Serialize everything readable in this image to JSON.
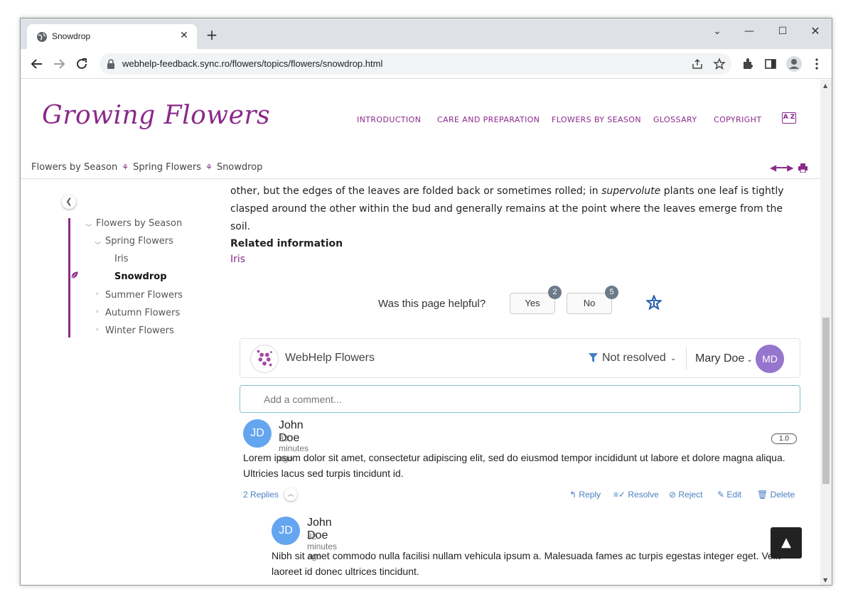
{
  "browser": {
    "tab_title": "Snowdrop",
    "url": "webhelp-feedback.sync.ro/flowers/topics/flowers/snowdrop.html"
  },
  "site": {
    "logo": "Growing Flowers",
    "nav": [
      "INTRODUCTION",
      "CARE AND PREPARATION",
      "FLOWERS BY SEASON",
      "GLOSSARY",
      "COPYRIGHT"
    ],
    "az_label": "A Z"
  },
  "breadcrumb": [
    "Flowers by Season",
    "Spring Flowers",
    "Snowdrop"
  ],
  "toc": {
    "root": "Flowers by Season",
    "spring": "Spring Flowers",
    "iris": "Iris",
    "snowdrop": "Snowdrop",
    "summer": "Summer Flowers",
    "autumn": "Autumn Flowers",
    "winter": "Winter Flowers"
  },
  "article": {
    "para_part1": "other, but the edges of the leaves are folded back or sometimes rolled; in ",
    "para_em": "supervolute",
    "para_part2": " plants one leaf is tightly clasped around the other within the bud and generally remains at the point where the leaves emerge from the soil.",
    "related_heading": "Related information",
    "related_link": "Iris"
  },
  "feedback": {
    "question": "Was this page helpful?",
    "yes_label": "Yes",
    "yes_count": "2",
    "no_label": "No",
    "no_count": "5",
    "site_name": "WebHelp Flowers",
    "filter_label": "Not resolved",
    "user_name": "Mary Doe",
    "user_initials": "MD",
    "add_comment_placeholder": "Add a comment..."
  },
  "comments": [
    {
      "initials": "JD",
      "author": "John Doe",
      "time": "33 minutes ago",
      "version": "1.0",
      "body": "Lorem ipsum dolor sit amet, consectetur adipiscing elit, sed do eiusmod tempor incididunt ut labore et dolore magna aliqua. Ultricies lacus sed turpis tincidunt id.",
      "replies_label": "2 Replies",
      "actions": {
        "reply": "Reply",
        "resolve": "Resolve",
        "reject": "Reject",
        "edit": "Edit",
        "delete": "Delete"
      }
    },
    {
      "initials": "JD",
      "author": "John Doe",
      "time": "32 minutes ago",
      "body": "Nibh sit amet commodo nulla facilisi nullam vehicula ipsum a. Malesuada fames ac turpis egestas integer eget. Velit laoreet id donec ultrices tincidunt."
    }
  ],
  "colors": {
    "brand": "#8a2a8a",
    "link": "#4a7fc1",
    "avatar_user": "#9575cd",
    "avatar_author": "#64a5f0"
  }
}
